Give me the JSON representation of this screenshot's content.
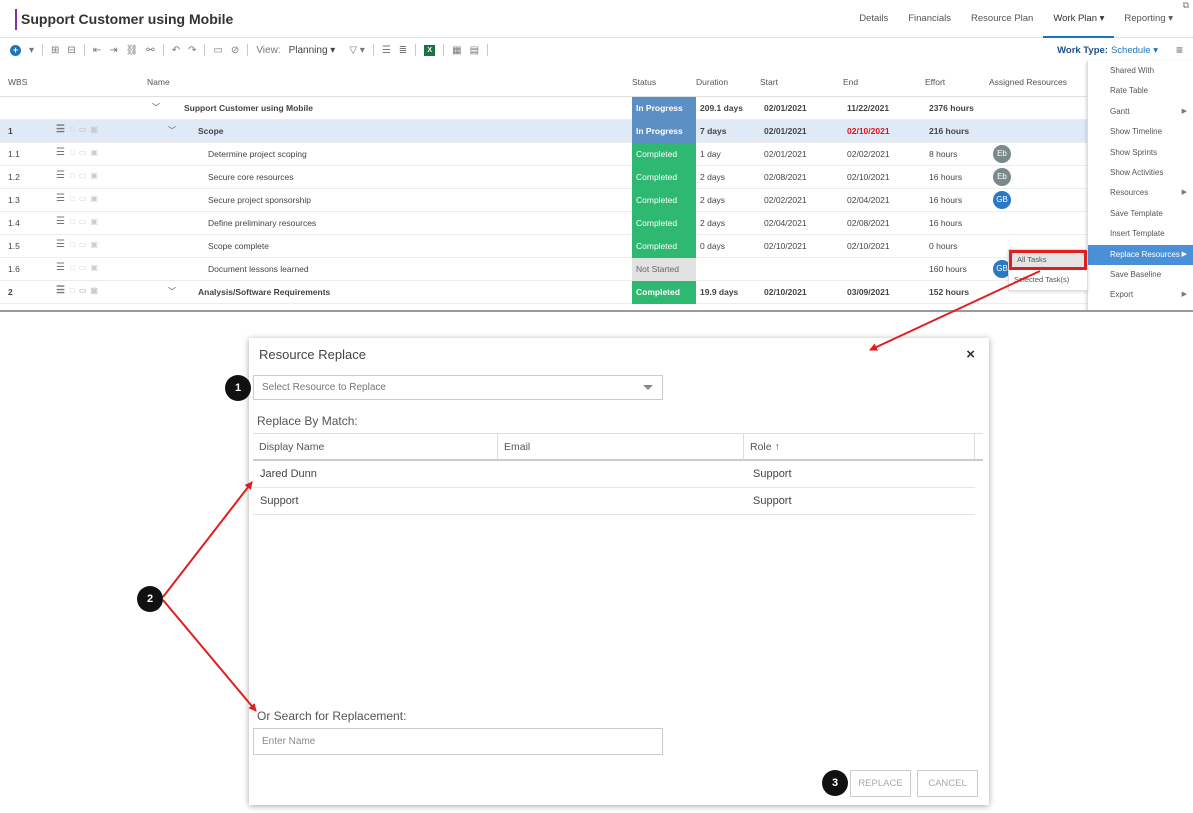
{
  "app": {
    "project_title": "Support Customer using Mobile",
    "title_more": "···",
    "top_tabs": [
      "Details",
      "Financials",
      "Resource Plan",
      "Work Plan ▾",
      "Reporting ▾"
    ],
    "toolbar": {
      "view_label": "View:",
      "view_value": "Planning ▾",
      "work_type_label": "Work Type:",
      "work_type_value": "Schedule ▾"
    },
    "columns": [
      "WBS",
      "Name",
      "Status",
      "Duration",
      "Start",
      "End",
      "Effort",
      "Assigned Resources"
    ],
    "rows": [
      {
        "wbs": "",
        "name": "Support Customer using Mobile",
        "status": "In Progress",
        "duration": "209.1 days",
        "start": "02/01/2021",
        "end": "11/22/2021",
        "effort": "2376 hours",
        "avatar": ""
      },
      {
        "wbs": "1",
        "name": "Scope",
        "status": "In Progress",
        "duration": "7 days",
        "start": "02/01/2021",
        "end": "02/10/2021",
        "effort": "216 hours",
        "avatar": ""
      },
      {
        "wbs": "1.1",
        "name": "Determine project scoping",
        "status": "Completed",
        "duration": "1 day",
        "start": "02/01/2021",
        "end": "02/02/2021",
        "effort": "8 hours",
        "avatar": "Eb"
      },
      {
        "wbs": "1.2",
        "name": "Secure core resources",
        "status": "Completed",
        "duration": "2 days",
        "start": "02/08/2021",
        "end": "02/10/2021",
        "effort": "16 hours",
        "avatar": "Eb"
      },
      {
        "wbs": "1.3",
        "name": "Secure project sponsorship",
        "status": "Completed",
        "duration": "2 days",
        "start": "02/02/2021",
        "end": "02/04/2021",
        "effort": "16 hours",
        "avatar": "GB"
      },
      {
        "wbs": "1.4",
        "name": "Define preliminary resources",
        "status": "Completed",
        "duration": "2 days",
        "start": "02/04/2021",
        "end": "02/08/2021",
        "effort": "16 hours",
        "avatar": ""
      },
      {
        "wbs": "1.5",
        "name": "Scope complete",
        "status": "Completed",
        "duration": "0 days",
        "start": "02/10/2021",
        "end": "02/10/2021",
        "effort": "0 hours",
        "avatar": ""
      },
      {
        "wbs": "1.6",
        "name": "Document lessons learned",
        "status": "Not Started",
        "duration": "",
        "start": "",
        "end": "",
        "effort": "160 hours",
        "avatar": "GB"
      },
      {
        "wbs": "2",
        "name": "Analysis/Software Requirements",
        "status": "Completed",
        "duration": "19.9 days",
        "start": "02/10/2021",
        "end": "03/09/2021",
        "effort": "152 hours",
        "avatar": ""
      }
    ],
    "menu": [
      "Shared With",
      "Rate Table",
      "Gantt",
      "Show Timeline",
      "Show Sprints",
      "Show Activities",
      "Resources",
      "Save Template",
      "Insert Template",
      "Replace Resources",
      "Save Baseline",
      "Export"
    ],
    "submenu": [
      "All Tasks",
      "Selected Task(s)"
    ]
  },
  "dialog": {
    "title": "Resource Replace",
    "close": "×",
    "select_placeholder": "Select Resource to Replace",
    "match_label": "Replace By Match:",
    "columns": [
      "Display Name",
      "Email",
      "Role ↑"
    ],
    "rows": [
      {
        "name": "Jared Dunn",
        "email": "",
        "role": "Support"
      },
      {
        "name": "Support",
        "email": "",
        "role": "Support"
      }
    ],
    "search_label": "Or Search for Replacement:",
    "search_placeholder": "Enter Name",
    "replace_button": "REPLACE",
    "cancel_button": "CANCEL"
  },
  "callouts": [
    "1",
    "2",
    "3"
  ],
  "colors": {
    "accent": "#1b75bb",
    "in_progress": "#5c8fc4",
    "completed": "#2eb872",
    "not_started": "#e2e2e2",
    "annotation_red": "#e01e1e"
  }
}
